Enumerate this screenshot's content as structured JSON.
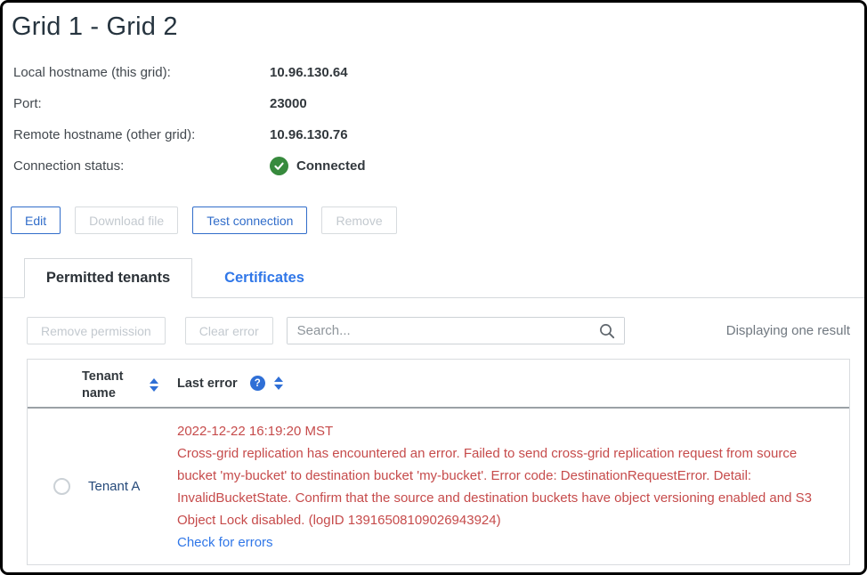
{
  "page": {
    "title": "Grid 1 - Grid 2"
  },
  "details": [
    {
      "label": "Local hostname (this grid):",
      "value": "10.96.130.64"
    },
    {
      "label": "Port:",
      "value": "23000"
    },
    {
      "label": "Remote hostname (other grid):",
      "value": "10.96.130.76"
    },
    {
      "label": "Connection status:",
      "value": "Connected"
    }
  ],
  "actions": {
    "edit": "Edit",
    "download": "Download file",
    "test": "Test connection",
    "remove": "Remove"
  },
  "tabs": [
    {
      "label": "Permitted tenants",
      "active": true
    },
    {
      "label": "Certificates",
      "active": false
    }
  ],
  "toolbar": {
    "remove_permission": "Remove permission",
    "clear_error": "Clear error",
    "search_placeholder": "Search...",
    "results_text": "Displaying one result"
  },
  "table": {
    "columns": [
      {
        "label": "Tenant name",
        "sortable": true
      },
      {
        "label": "Last error",
        "sortable": true,
        "has_help": true
      }
    ],
    "rows": [
      {
        "tenant": "Tenant A",
        "error_time": "2022-12-22 16:19:20 MST",
        "error_message": "Cross-grid replication has encountered an error. Failed to send cross-grid replication request from source bucket 'my-bucket' to destination bucket 'my-bucket'. Error code: DestinationRequestError. Detail: InvalidBucketState. Confirm that the source and destination buckets have object versioning enabled and S3 Object Lock disabled. (logID 13916508109026943924)",
        "error_link": "Check for errors"
      }
    ]
  },
  "icons": {
    "connected": "check-circle",
    "search": "magnifier",
    "help": "?",
    "sort": "up-down-triangles",
    "radio": "radio-circle"
  },
  "colors": {
    "accent_blue": "#316dca",
    "link_blue": "#3077e8",
    "tenant_navy": "#264a7a",
    "error_red": "#c64b4b",
    "success_green": "#378a3d",
    "disabled_gray": "#c3c9cf"
  }
}
